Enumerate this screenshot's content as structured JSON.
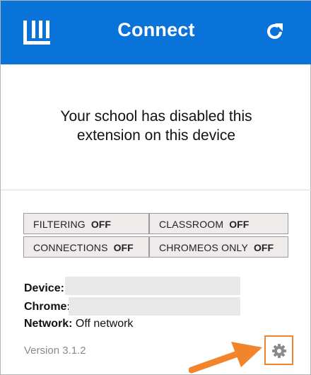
{
  "header": {
    "title": "Connect",
    "logo_icon": "linewize-logo-icon",
    "refresh_icon": "refresh-icon",
    "bg_color": "#0a73d9"
  },
  "message": {
    "line1": "Your school has disabled this",
    "line2": "extension on this device"
  },
  "status": [
    {
      "label": "FILTERING",
      "value": "OFF"
    },
    {
      "label": "CLASSROOM",
      "value": "OFF"
    },
    {
      "label": "CONNECTIONS",
      "value": "OFF"
    },
    {
      "label": "CHROMEOS ONLY",
      "value": "OFF"
    }
  ],
  "info": {
    "device_label": "Device:",
    "device_value": "",
    "chrome_label": "Chrome:",
    "chrome_value": "",
    "network_label": "Network:",
    "network_value": "Off network"
  },
  "footer": {
    "version": "Version 3.1.2",
    "settings_icon": "gear-icon",
    "highlight_color": "#f2852b"
  }
}
